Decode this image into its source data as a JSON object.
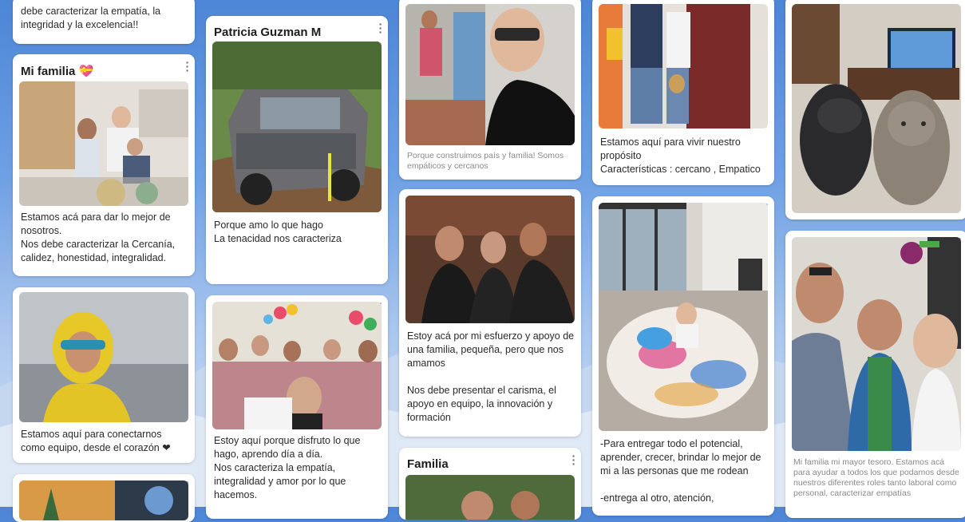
{
  "cards": {
    "c1": {
      "text": "debe caracterizar la empatía, la\nintegridad y la excelencia!!"
    },
    "c2": {
      "title": "Mi familia",
      "emoji": "💝",
      "text": "Estamos acá para dar lo mejor de nosotros.\nNos debe caracterizar la Cercanía, calidez, honestidad, integralidad."
    },
    "c3": {
      "text": "Estamos aquí para conectarnos como equipo, desde el corazón ❤"
    },
    "c5": {
      "title": "Patricia Guzman M",
      "text": "Porque amo lo que hago\nLa tenacidad nos caracteriza"
    },
    "c6": {
      "text": "Estoy aquí porque disfruto lo que hago, aprendo día a día.\nNos caracteriza la empatía, integralidad y amor por lo que hacemos."
    },
    "c7": {
      "text": "Porque construimos país y familia! Somos empáticos y cercanos"
    },
    "c8": {
      "text": "Estoy acá por mi esfuerzo y apoyo de una familia, pequeña, pero que nos amamos\n\nNos debe presentar el carisma, el apoyo en equipo, la innovación y formación"
    },
    "c9": {
      "title": "Familia"
    },
    "c10": {
      "text": "Estamos aquí para vivir nuestro propósito\nCaracterísticas : cercano , Empatico"
    },
    "c11": {
      "text": "-Para entregar todo el potencial, aprender, crecer, brindar lo mejor de mi a las personas que me rodean\n\n-entrega al otro, atención,"
    },
    "c13": {
      "text": "Mi familia mi mayor tesoro. Estamos acá para ayudar a todos los que podamos desde nuestros diferentes roles tanto laboral como personal, caracterizar empatías"
    }
  },
  "colors": {
    "accent": "#4d86d6",
    "card": "#ffffff",
    "text": "#2a2a2a"
  },
  "icons": {
    "menu": "more-vert-icon"
  }
}
